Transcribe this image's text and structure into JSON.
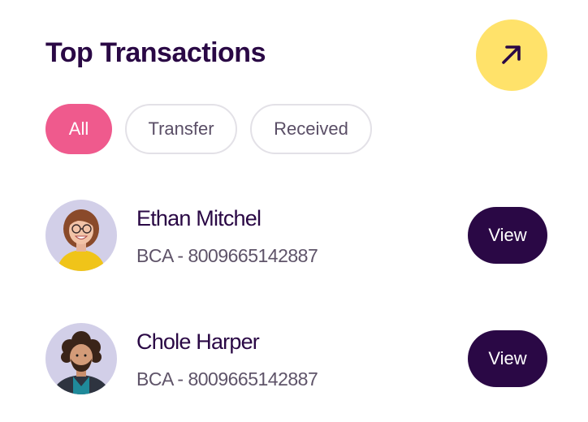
{
  "header": {
    "title": "Top Transactions",
    "open_icon": "arrow-up-right-icon"
  },
  "filters": [
    {
      "label": "All",
      "active": true
    },
    {
      "label": "Transfer",
      "active": false
    },
    {
      "label": "Received",
      "active": false
    }
  ],
  "transactions": [
    {
      "name": "Ethan Mitchel",
      "account": "BCA - 8009665142887",
      "action_label": "View",
      "avatar_icon": "avatar-woman-glasses"
    },
    {
      "name": "Chole Harper",
      "account": "BCA - 8009665142887",
      "action_label": "View",
      "avatar_icon": "avatar-man-curly-hair"
    }
  ],
  "colors": {
    "primary": "#2a0845",
    "accent_pink": "#ef5a8d",
    "accent_yellow": "#ffe26a",
    "avatar_bg": "#d2cfe8"
  }
}
